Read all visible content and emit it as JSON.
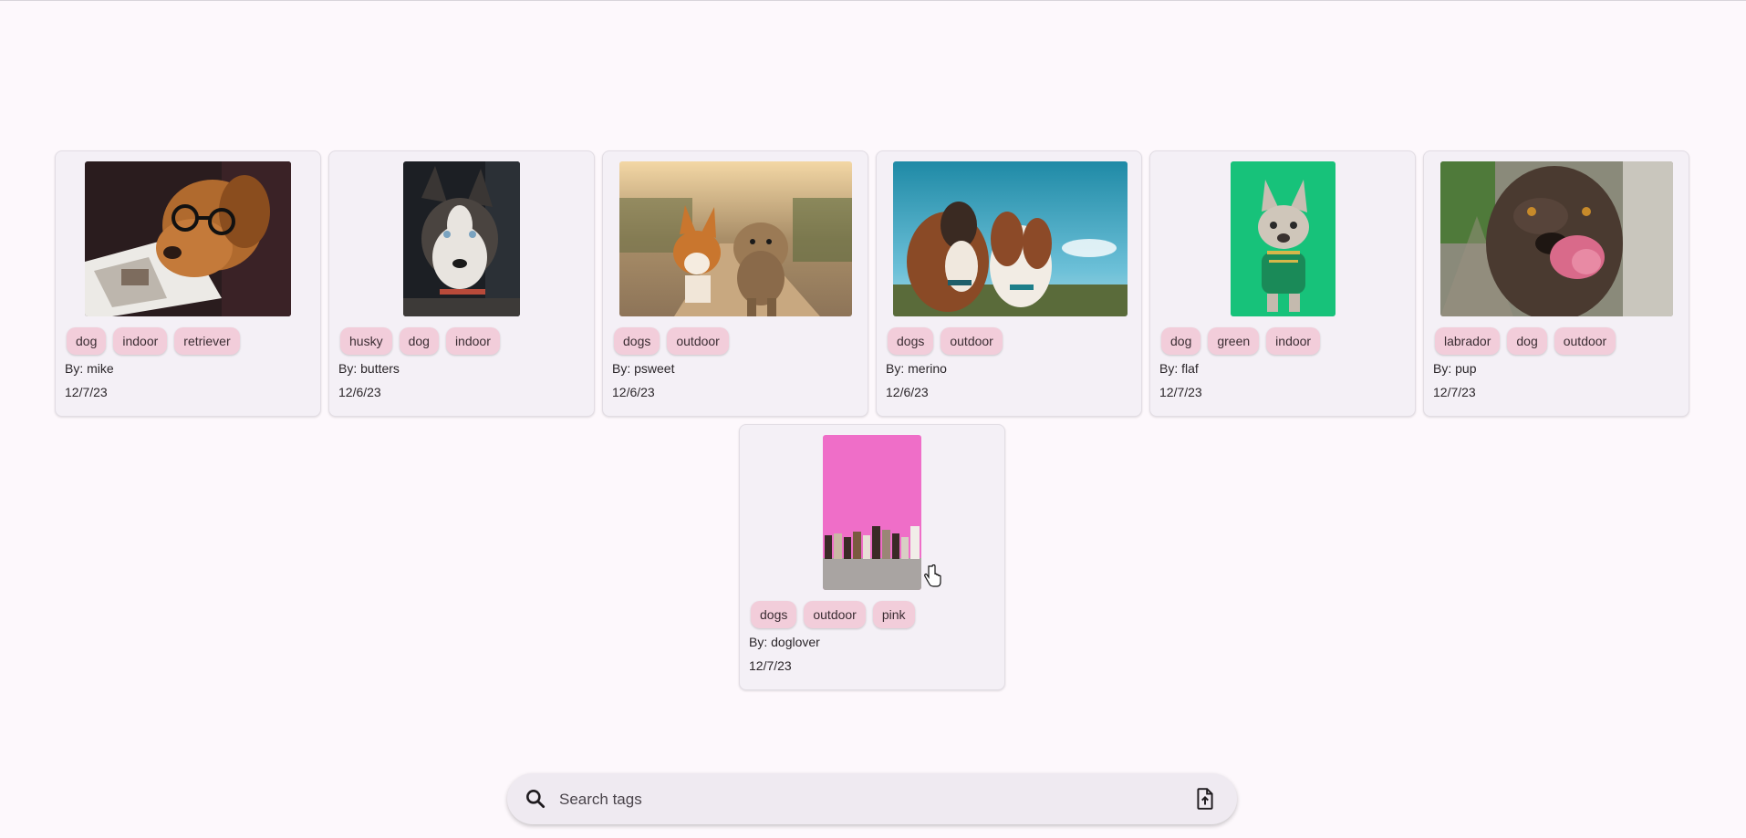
{
  "gallery": {
    "posts": [
      {
        "tags": [
          "dog",
          "indoor",
          "retriever"
        ],
        "author_label": "By: mike",
        "date": "12/7/23",
        "image": "golden retriever wearing glasses reading a magazine"
      },
      {
        "tags": [
          "husky",
          "dog",
          "indoor"
        ],
        "author_label": "By: butters",
        "date": "12/6/23",
        "image": "husky portrait on dark background"
      },
      {
        "tags": [
          "dogs",
          "outdoor"
        ],
        "author_label": "By: psweet",
        "date": "12/6/23",
        "image": "corgi and yorkshire terrier running on a dirt road"
      },
      {
        "tags": [
          "dogs",
          "outdoor"
        ],
        "author_label": "By: merino",
        "date": "12/6/23",
        "image": "two dogs looking up at a blue sky"
      },
      {
        "tags": [
          "dog",
          "green",
          "indoor"
        ],
        "author_label": "By: flaf",
        "date": "12/7/23",
        "image": "french bulldog in a green vest on green background"
      },
      {
        "tags": [
          "labrador",
          "dog",
          "outdoor"
        ],
        "author_label": "By: pup",
        "date": "12/7/23",
        "image": "chocolate labrador licking its nose"
      },
      {
        "tags": [
          "dogs",
          "outdoor",
          "pink"
        ],
        "author_label": "By: doglover",
        "date": "12/7/23",
        "image": "row of dogs sitting in front of a pink wall"
      }
    ]
  },
  "search": {
    "placeholder": "Search tags",
    "value": "",
    "search_icon": "search-icon",
    "upload_icon": "upload-file-icon"
  },
  "colors": {
    "background": "#fdf8fc",
    "card": "#f4f0f6",
    "chip": "#f2cdda",
    "searchbar": "#efeaf1"
  }
}
